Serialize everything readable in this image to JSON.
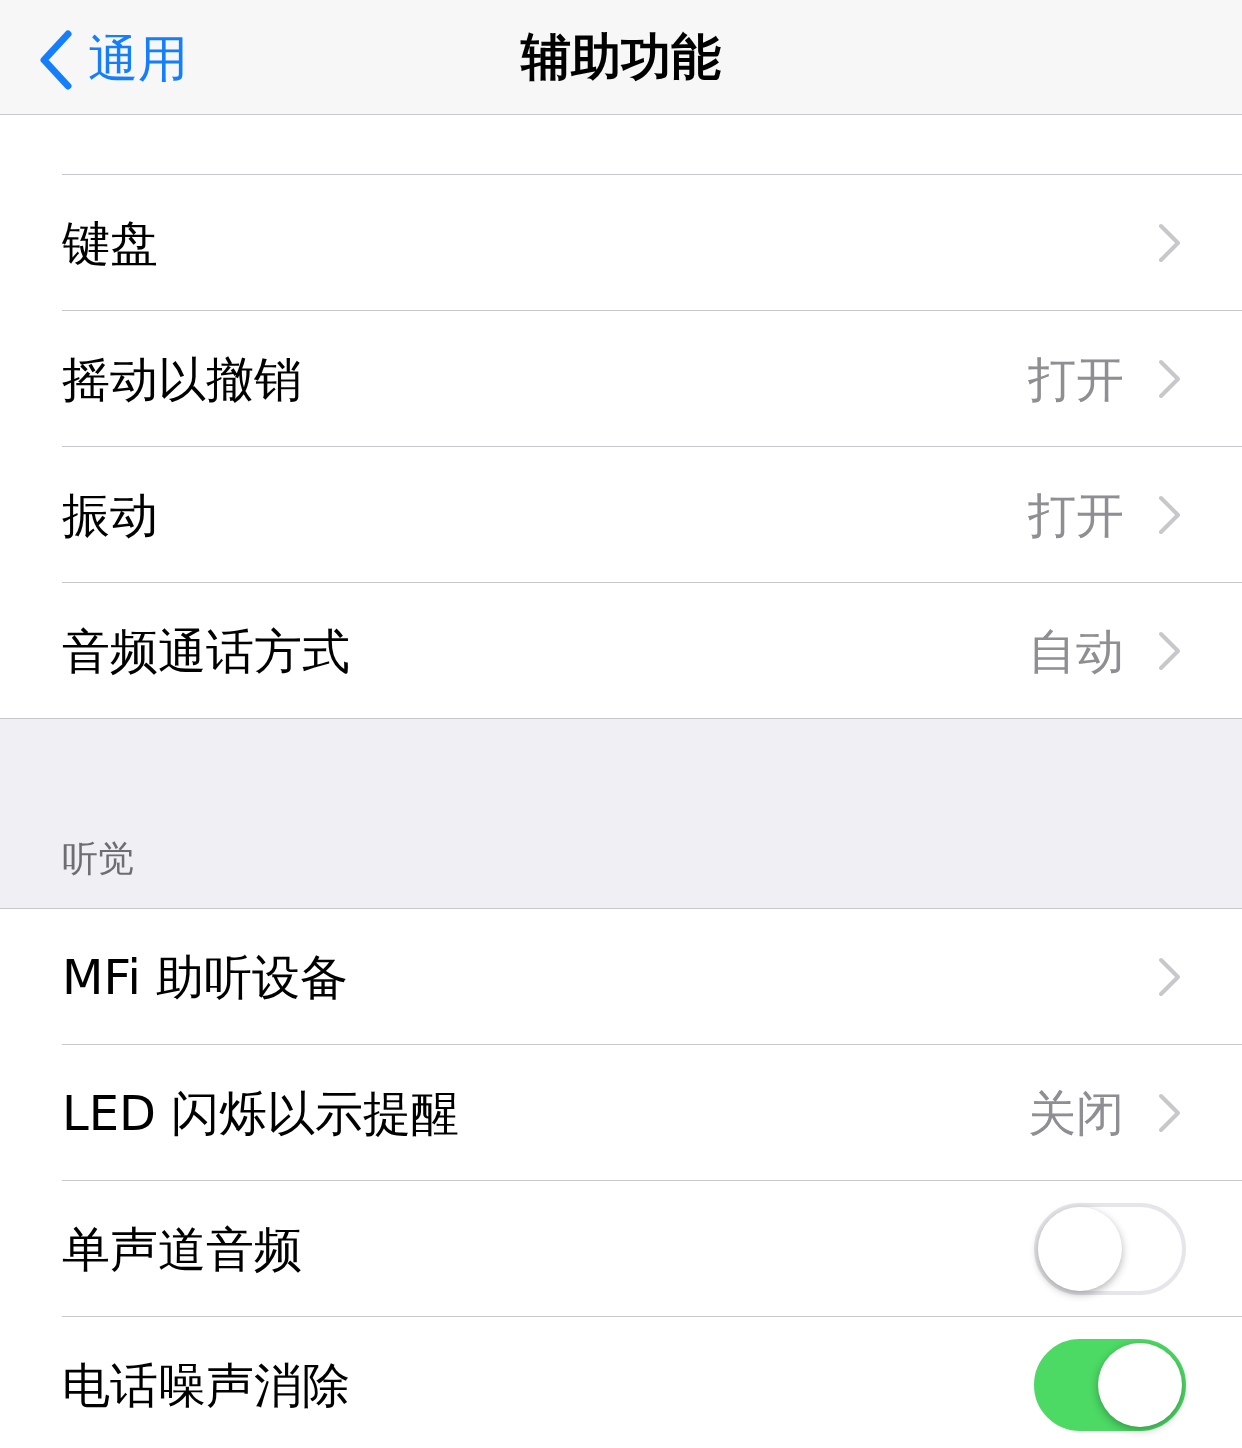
{
  "nav": {
    "back": "通用",
    "title": "辅助功能"
  },
  "sections": [
    {
      "rows": [
        {
          "kind": "link",
          "label": "键盘"
        },
        {
          "kind": "link",
          "label": "摇动以撤销",
          "value": "打开"
        },
        {
          "kind": "link",
          "label": "振动",
          "value": "打开"
        },
        {
          "kind": "link",
          "label": "音频通话方式",
          "value": "自动"
        }
      ]
    },
    {
      "header": "听觉",
      "rows": [
        {
          "kind": "link",
          "label": "MFi 助听设备"
        },
        {
          "kind": "link",
          "label": "LED 闪烁以示提醒",
          "value": "关闭"
        },
        {
          "kind": "toggle",
          "label": "单声道音频",
          "on": false
        },
        {
          "kind": "toggle",
          "label": "电话噪声消除",
          "on": true
        }
      ]
    }
  ]
}
